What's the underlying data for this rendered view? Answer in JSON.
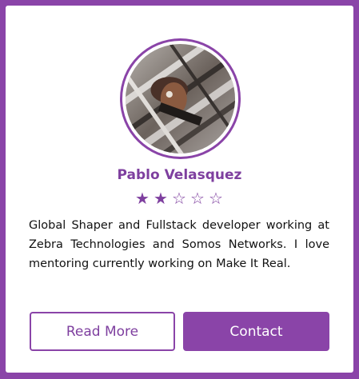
{
  "profile": {
    "name": "Pablo Velasquez",
    "rating": 2,
    "rating_max": 5,
    "bio": "Global Shaper and Fullstack developer working at Zebra Technologies and Somos Networks. I love mentoring currently working on Make It Real."
  },
  "actions": {
    "read_more_label": "Read More",
    "contact_label": "Contact"
  },
  "colors": {
    "accent": "#8a44a8",
    "accent_text": "#7e3f9f",
    "background": "#8a44a8",
    "card": "#ffffff"
  },
  "icons": {
    "star_filled": "★",
    "star_empty": "☆"
  }
}
